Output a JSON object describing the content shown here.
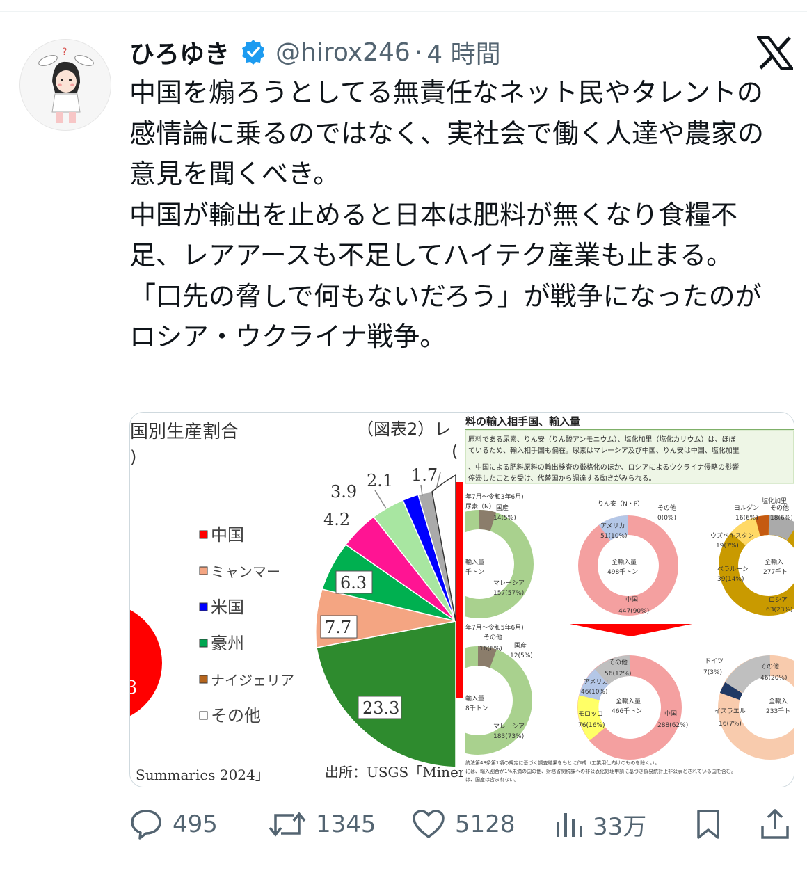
{
  "tweet": {
    "display_name": "ひろゆき",
    "handle": "@hirox246",
    "separator": "·",
    "time": "4 時間",
    "text_lines": [
      "中国を煽ろうとしてる無責任なネット民やタレントの感情論に乗るのではなく、実社会で働く人達や農家の意見を聞くべき。",
      "中国が輸出を止めると日本は肥料が無くなり食糧不足、レアアースも不足してハイテク産業も止まる。",
      "「口先の脅しで何もないだろう」が戦争になったのがロシア・ウクライナ戦争。"
    ]
  },
  "media_left": {
    "heading_1": "国別生産割合",
    "heading_2": "（図表2）レ",
    "paren_left": ")",
    "paren_right": "(",
    "legend": [
      "中国",
      "ミャンマー",
      "米国",
      "豪州",
      "ナイジェリア",
      "その他"
    ],
    "legend_colors": [
      "#ff0000",
      "#f4a582",
      "#0000ff",
      "#00a651",
      "#b5651d",
      "#ffffff"
    ],
    "pie_labels": [
      "3.9",
      "2.1",
      "1.7",
      "4.2",
      "6.3",
      "7.7",
      "23.3"
    ],
    "left_edge_digit": "3",
    "footer_left": "Summaries 2024」",
    "footer_right": "出所：USGS「Miner"
  },
  "media_right": {
    "title": "料の輸入相手国、輸入量",
    "note_1": "原料である尿素、りん安（りん酸アンモニウム）、塩化加里（塩化カリウム）は、ほぼ",
    "note_2": "ているため、輸入相手国も偏在。尿素はマレーシア及び中国、りん安は中国、塩化加里",
    "note_3": "、中国による肥料原料の輸出検査の厳格化のほか、ロシアによるウクライナ侵略の影響",
    "note_4": "停滞したことを受け、代替国から調達する動きがみられる。",
    "period_1": "年7月～令和3年6月)",
    "period_2": "年7月～令和5年6月)",
    "urea_label": "尿素（N）",
    "rinan_label": "りん安（N・P）",
    "kari_label": "塩化加里",
    "top_left": {
      "center_1": "輸入量",
      "center_2": "千トン",
      "labels": [
        "国産",
        "14(5%)",
        "マレーシア",
        "157(57%)"
      ]
    },
    "top_mid": {
      "center_1": "全輸入量",
      "center_2": "498千トン",
      "labels": [
        "その他",
        "0(0%)",
        "アメリカ",
        "51(10%)",
        "中国",
        "447(90%)"
      ]
    },
    "top_right": {
      "center_1": "全輸入",
      "center_2": "277千ト",
      "labels": [
        "ヨルダン",
        "16(6%)",
        "その他",
        "18(6%)",
        "ウズベキスタン",
        "19(7%)",
        "ベラルーシ",
        "39(14%)",
        "ロシア",
        "63(23%)"
      ]
    },
    "bottom_left": {
      "center_1": "輸入量",
      "center_2": "8千トン",
      "labels": [
        "その他",
        "16(6%)",
        "国産",
        "12(5%)",
        "マレーシア",
        "183(73%)"
      ]
    },
    "bottom_mid": {
      "center_1": "全輸入量",
      "center_2": "466千トン",
      "labels": [
        "その他",
        "56(12%)",
        "アメリカ",
        "46(10%)",
        "モロッコ",
        "76(16%)",
        "中国",
        "288(62%)"
      ]
    },
    "bottom_right": {
      "center_1": "全輸入",
      "center_2": "233千ト",
      "labels": [
        "ドイツ",
        "7(3%)",
        "その他",
        "46(20%)",
        "イスラエル",
        "16(7%)"
      ]
    },
    "footnote_1": "統法第48条第1項の規定に基づく調査結果をもとに作成（工業用仕向けのものを除く。）。",
    "footnote_2": "には、輸入割合が1%未満の国の他、財務省関税課への非公表化処理申請に基づき貿易統計上非公表とされている国を含む。",
    "footnote_3": "は、国産は含まれない。"
  },
  "actions": {
    "replies": "495",
    "retweets": "1345",
    "likes": "5128",
    "views": "33万"
  },
  "colors": {
    "verified": "#1d9bf0",
    "muted_text": "#536471",
    "pie_green_dark": "#2e8b2e",
    "pie_salmon": "#f4a582",
    "donut_pink": "#f4a0a0",
    "donut_green": "#a9d18e"
  }
}
